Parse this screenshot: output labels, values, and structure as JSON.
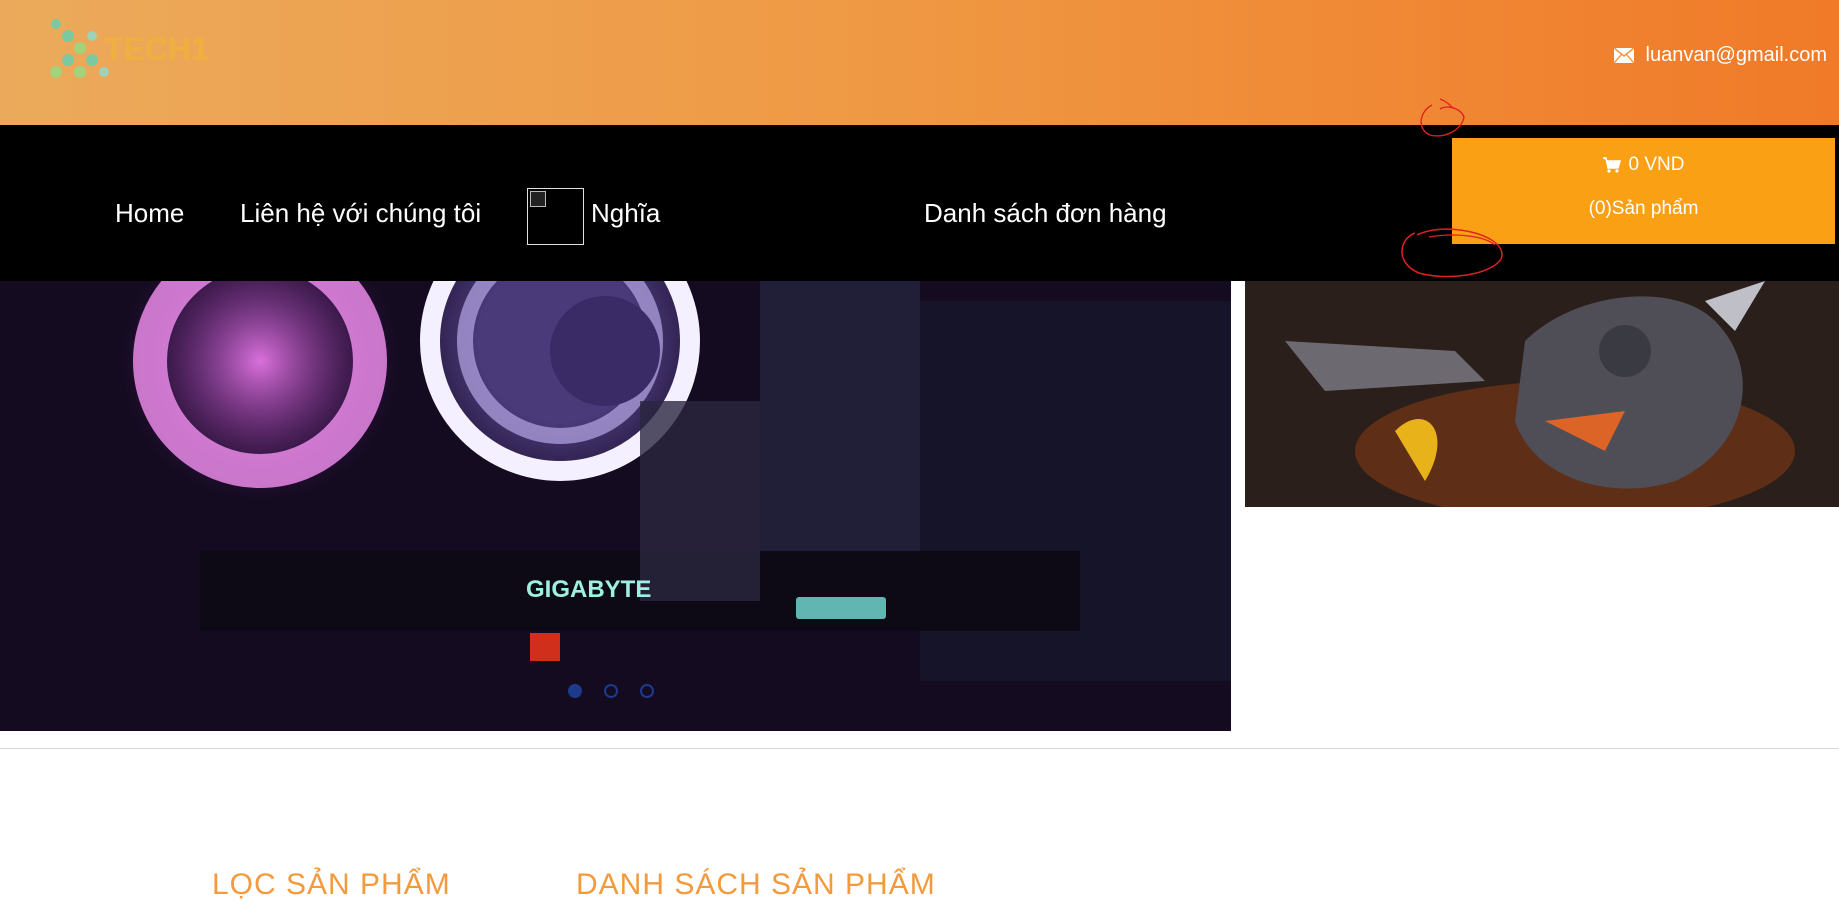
{
  "header": {
    "logo_text": "TECH1",
    "email": "luanvan@gmail.com",
    "email_icon": "mail-icon"
  },
  "nav": {
    "home": "Home",
    "contact": "Liên hệ với chúng tôi",
    "user_name": "Nghĩa",
    "orders": "Danh sách đơn hàng"
  },
  "cart": {
    "icon": "cart-icon",
    "total": "0 VND",
    "count_label": "(0)Sản phẩm"
  },
  "slider": {
    "brand_text": "GIGABYTE",
    "active_slide": 1,
    "slide_count": 3
  },
  "sections": {
    "filter_title": "LỌC SẢN PHẨM",
    "list_title": "DANH SÁCH SẢN PHẨM"
  },
  "colors": {
    "header_gradient_start": "#ebaa5b",
    "header_gradient_end": "#f07a28",
    "nav_bg": "#000000",
    "cart_bg": "#f9a015",
    "accent_title": "#f39a3c",
    "annotation": "#e02020"
  }
}
